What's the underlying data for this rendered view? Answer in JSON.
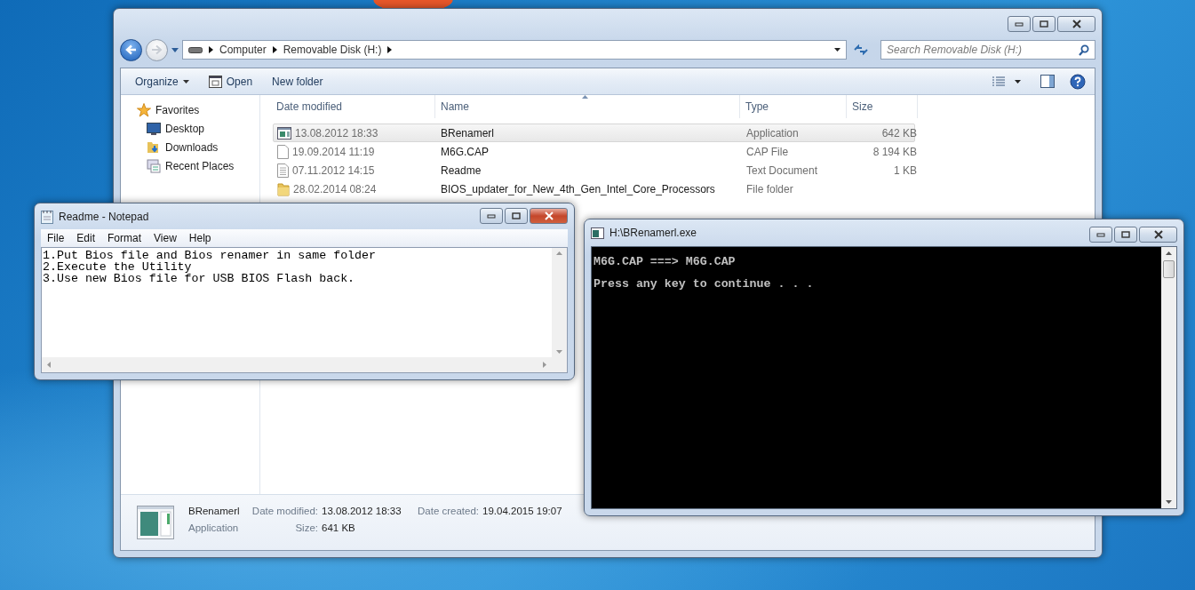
{
  "explorer": {
    "breadcrumb": [
      "Computer",
      "Removable Disk (H:)"
    ],
    "search": {
      "placeholder": "Search Removable Disk (H:)"
    },
    "toolbar": [
      {
        "label": "Organize",
        "kind": "menu"
      },
      {
        "label": "Open",
        "kind": "open"
      },
      {
        "label": "New folder",
        "kind": "plain"
      }
    ],
    "sidebar": {
      "title": "Favorites",
      "items": [
        {
          "label": "Desktop",
          "kind": "desktop"
        },
        {
          "label": "Downloads",
          "kind": "downloads"
        },
        {
          "label": "Recent Places",
          "kind": "recent"
        }
      ]
    },
    "table": {
      "columns": [
        "Date modified",
        "Name",
        "Type",
        "Size"
      ],
      "rows": [
        {
          "date": "13.08.2012 18:33",
          "name": "BRenamerl",
          "type": "Application",
          "size": "642 KB",
          "kind": "application",
          "selected": true
        },
        {
          "date": "19.09.2014 11:19",
          "name": "M6G.CAP",
          "type": "CAP File",
          "size": "8 194 KB",
          "kind": "file",
          "selected": false
        },
        {
          "date": "07.11.2012 14:15",
          "name": "Readme",
          "type": "Text Document",
          "size": "1 KB",
          "kind": "text",
          "selected": false
        },
        {
          "date": "28.02.2014 08:24",
          "name": "BIOS_updater_for_New_4th_Gen_Intel_Core_Processors",
          "type": "File folder",
          "kind": "folder",
          "selected": false
        }
      ]
    },
    "details": {
      "name": "BRenamerl",
      "type": "Application",
      "fields": [
        {
          "label": "Date modified:",
          "value": "13.08.2012 18:33"
        },
        {
          "label": "Size:",
          "value": "641 KB"
        },
        {
          "label": "Date created:",
          "value": "19.04.2015 19:07"
        }
      ]
    }
  },
  "notepad": {
    "title": "Readme - Notepad",
    "menu": [
      "File",
      "Edit",
      "Format",
      "View",
      "Help"
    ],
    "lines": [
      "1.Put Bios file and Bios renamer in same folder",
      "2.Execute the Utility",
      "3.Use new Bios file for USB BIOS Flash back."
    ]
  },
  "console": {
    "title": "H:\\BRenamerl.exe",
    "lines": [
      "M6G.CAP ===> M6G.CAP",
      "Press any key to continue . . ."
    ]
  }
}
